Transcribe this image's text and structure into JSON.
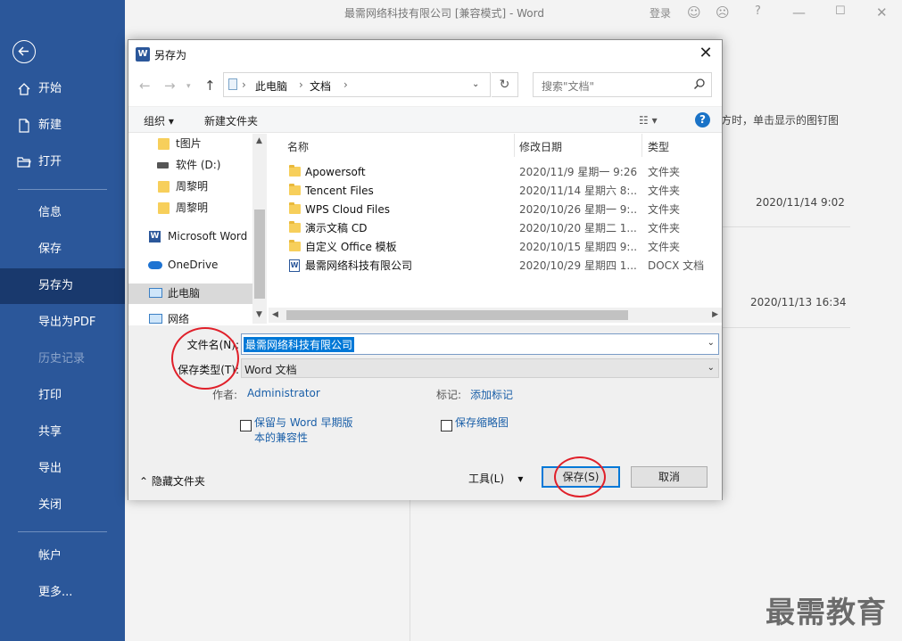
{
  "window": {
    "title": "最需网络科技有限公司 [兼容模式]  -  Word",
    "login": "登录",
    "buttons": [
      "smiley-icon",
      "frown-icon",
      "help-icon",
      "minimize-icon",
      "maximize-icon",
      "close-icon"
    ]
  },
  "backstage": {
    "items": [
      {
        "label": "开始",
        "icon": "home-icon"
      },
      {
        "label": "新建",
        "icon": "new-doc-icon"
      },
      {
        "label": "打开",
        "icon": "open-folder-icon"
      },
      {
        "label": "信息"
      },
      {
        "label": "保存"
      },
      {
        "label": "另存为",
        "active": true
      },
      {
        "label": "导出为PDF"
      },
      {
        "label": "历史记录",
        "disabled": true
      },
      {
        "label": "打印"
      },
      {
        "label": "共享"
      },
      {
        "label": "导出"
      },
      {
        "label": "关闭"
      },
      {
        "label": "帐户"
      },
      {
        "label": "更多..."
      }
    ],
    "accent": "#2b579a"
  },
  "background": {
    "hint_text": "方时，单击显示的图钉图",
    "time1": "2020/11/14 9:02",
    "time2": "2020/11/13 16:34",
    "watermark": "最需教育"
  },
  "dialog": {
    "title": "另存为",
    "address": {
      "segments": [
        "此电脑",
        "文档"
      ]
    },
    "search_placeholder": "搜索\"文档\"",
    "toolbar": {
      "organize": "组织",
      "new_folder": "新建文件夹"
    },
    "nav": [
      {
        "label": "t图片",
        "icon": "folder-icon"
      },
      {
        "label": "软件 (D:)",
        "icon": "drive-icon"
      },
      {
        "label": "周黎明",
        "icon": "folder-icon"
      },
      {
        "label": "周黎明",
        "icon": "folder-icon"
      },
      {
        "label": "Microsoft Word",
        "icon": "word-icon"
      },
      {
        "label": "OneDrive",
        "icon": "cloud-icon"
      },
      {
        "label": "此电脑",
        "icon": "computer-icon",
        "selected": true
      },
      {
        "label": "网络",
        "icon": "network-icon"
      }
    ],
    "columns": {
      "name": "名称",
      "date": "修改日期",
      "type": "类型"
    },
    "files": [
      {
        "name": "Apowersoft",
        "date": "2020/11/9 星期一 9:26",
        "type": "文件夹",
        "kind": "folder"
      },
      {
        "name": "Tencent Files",
        "date": "2020/11/14 星期六 8:...",
        "type": "文件夹",
        "kind": "folder"
      },
      {
        "name": "WPS Cloud Files",
        "date": "2020/10/26 星期一 9:...",
        "type": "文件夹",
        "kind": "folder"
      },
      {
        "name": "演示文稿 CD",
        "date": "2020/10/20 星期二 1...",
        "type": "文件夹",
        "kind": "folder"
      },
      {
        "name": "自定义 Office 模板",
        "date": "2020/10/15 星期四 9:...",
        "type": "文件夹",
        "kind": "folder"
      },
      {
        "name": "最需网络科技有限公司",
        "date": "2020/10/29 星期四 1...",
        "type": "DOCX 文档",
        "kind": "docx"
      }
    ],
    "form": {
      "filename_label": "文件名(N):",
      "filename_value": "最需网络科技有限公司",
      "filetype_label": "保存类型(T):",
      "filetype_value": "Word 文档",
      "author_label": "作者:",
      "author_value": "Administrator",
      "tags_label": "标记:",
      "tags_value": "添加标记",
      "compat_line1": "保留与 Word 早期版",
      "compat_line2": "本的兼容性",
      "thumbnail": "保存缩略图"
    },
    "footer": {
      "hide_folders": "隐藏文件夹",
      "tools": "工具(L)",
      "save": "保存(S)",
      "cancel": "取消"
    }
  }
}
